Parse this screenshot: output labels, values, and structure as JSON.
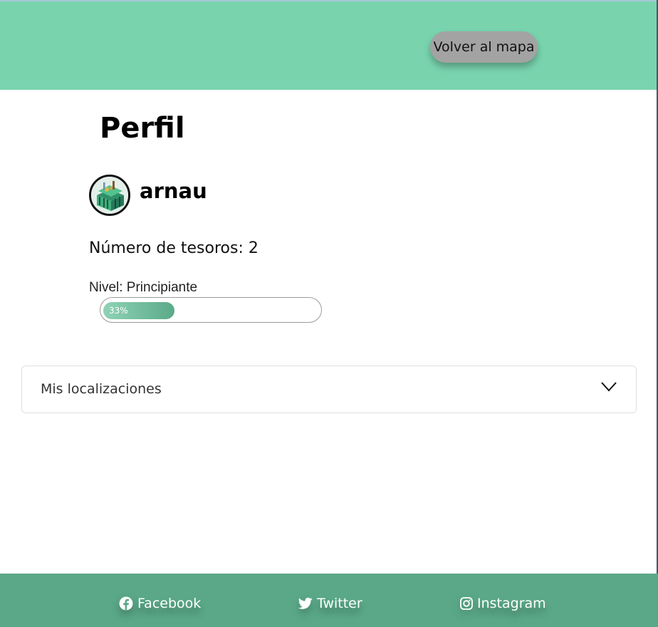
{
  "header": {
    "back_button_label": "Volver al mapa"
  },
  "profile": {
    "title": "Perfil",
    "username": "arnau",
    "treasures_text": "Número de tesoros: 2",
    "level_text": "Nivel: Principiante",
    "progress": {
      "percent": 33,
      "label": "33%"
    }
  },
  "accordion": {
    "label": "Mis localizaciones",
    "expanded": false
  },
  "footer": {
    "links": [
      {
        "label": "Facebook",
        "icon": "facebook-icon"
      },
      {
        "label": "Twitter",
        "icon": "twitter-icon"
      },
      {
        "label": "Instagram",
        "icon": "instagram-icon"
      }
    ]
  },
  "colors": {
    "header_bg": "#79d4ae",
    "footer_bg": "#5aa888",
    "button_bg": "#a3a3a3",
    "progress_fill": "#5aaa88"
  }
}
